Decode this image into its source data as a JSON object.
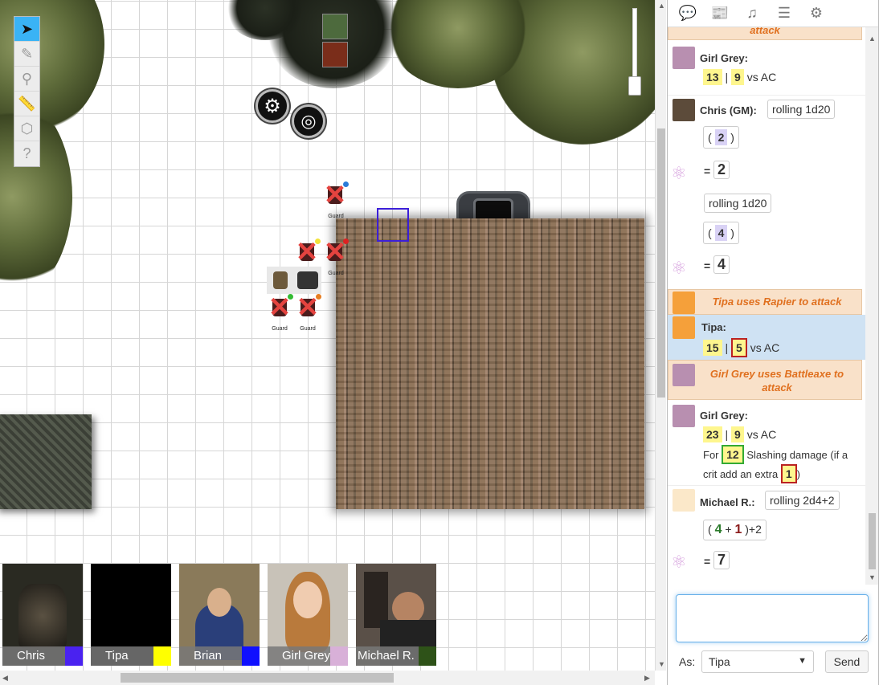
{
  "toolbar": {
    "tools": [
      "select",
      "draw",
      "zoom",
      "measure",
      "dice",
      "help"
    ]
  },
  "map": {
    "tokens": [
      {
        "label": "Guard"
      },
      {
        "label": "Guard"
      },
      {
        "label": "Guard"
      },
      {
        "label": "Guard"
      }
    ],
    "settings_button": "⚙",
    "turn_button": "◎"
  },
  "videos": [
    {
      "name": "Chris",
      "color": "#4a22f0"
    },
    {
      "name": "Tipa",
      "color": "#ffff00"
    },
    {
      "name": "Brian",
      "color": "#1010ff"
    },
    {
      "name": "Girl Grey",
      "color": "#d8b0d8"
    },
    {
      "name": "Michael R.",
      "color": "#2e5218"
    }
  ],
  "chat": {
    "top_emote_fragment": "attack",
    "messages": [
      {
        "who": "Girl Grey:",
        "roll1": "13",
        "sep": "|",
        "roll2": "9",
        "suffix": "vs AC"
      },
      {
        "who": "Chris (GM):",
        "formula1": "rolling 1d20",
        "die1": "2",
        "result1": "2",
        "formula2": "rolling 1d20",
        "die2": "4",
        "result2": "4"
      },
      {
        "emote": "Tipa uses Rapier to attack"
      },
      {
        "who": "Tipa:",
        "roll1": "15",
        "sep": "|",
        "roll2": "5",
        "suffix": "vs AC"
      },
      {
        "emote": "Girl Grey uses Battleaxe to attack"
      },
      {
        "who": "Girl Grey:",
        "roll1": "23",
        "sep": "|",
        "roll2": "9",
        "suffix": "vs AC",
        "for_label": "For",
        "damage": "12",
        "damage_text": "Slashing damage (if a crit add an extra",
        "extra": "1",
        "close": ")"
      },
      {
        "who": "Michael R.:",
        "formula": "rolling 2d4+2",
        "die1": "4",
        "plus": "+",
        "die2": "1",
        "mod": ")+2",
        "result": "7"
      }
    ],
    "equals": "="
  },
  "input": {
    "as_label": "As:",
    "as_value": "Tipa",
    "send_label": "Send"
  }
}
